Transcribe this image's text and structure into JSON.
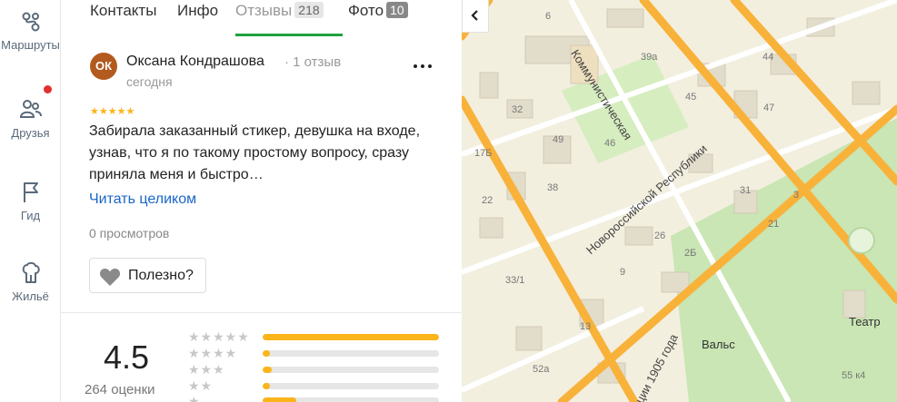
{
  "rail": {
    "items": [
      {
        "label": "Маршруты",
        "icon": "route-icon"
      },
      {
        "label": "Друзья",
        "icon": "friends-icon"
      },
      {
        "label": "Гид",
        "icon": "flag-icon"
      },
      {
        "label": "Жильё",
        "icon": "housing-icon"
      }
    ]
  },
  "tabs": [
    {
      "label": "Контакты"
    },
    {
      "label": "Инфо"
    },
    {
      "label": "Отзывы",
      "badge": "218"
    },
    {
      "label": "Фото",
      "badge": "10"
    }
  ],
  "review": {
    "avatar_initials": "ОК",
    "author": "Оксана Кондрашова",
    "author_meta": "· 1 отзыв",
    "date": "сегодня",
    "stars": "★★★★★",
    "text": "Забирала заказанный стикер, девушка на входе, узнав, что я по такому простому вопросу, сразу приняла меня и быстро…",
    "read_more": "Читать целиком",
    "views": "0 просмотров",
    "useful_label": "Полезно?"
  },
  "rating": {
    "score": "4.5",
    "count": "264 оценки",
    "rows": [
      {
        "stars": "★★★★★",
        "fraction": 1.0
      },
      {
        "stars": "★★★★",
        "fraction": 0.04
      },
      {
        "stars": "★★★",
        "fraction": 0.05
      },
      {
        "stars": "★★",
        "fraction": 0.04
      },
      {
        "stars": "★",
        "fraction": 0.19
      }
    ]
  },
  "map": {
    "numbers": [
      "6",
      "39а",
      "44",
      "45",
      "47",
      "32",
      "17Б",
      "49",
      "46",
      "38",
      "22",
      "3",
      "31",
      "21",
      "26",
      "2Б",
      "33/1",
      "9",
      "13",
      "52а",
      "55 к4"
    ],
    "streets": [
      "Коммунистическая",
      "Новороссийской Республики",
      "ции 1905 года"
    ],
    "pois": [
      "Вальс",
      "Театр"
    ]
  },
  "colors": {
    "accent_green": "#20a040",
    "star": "#fbb41a",
    "link": "#1966c7",
    "avatar": "#b35a1f",
    "road": "#f8b23a",
    "park": "#c9e6b4"
  }
}
